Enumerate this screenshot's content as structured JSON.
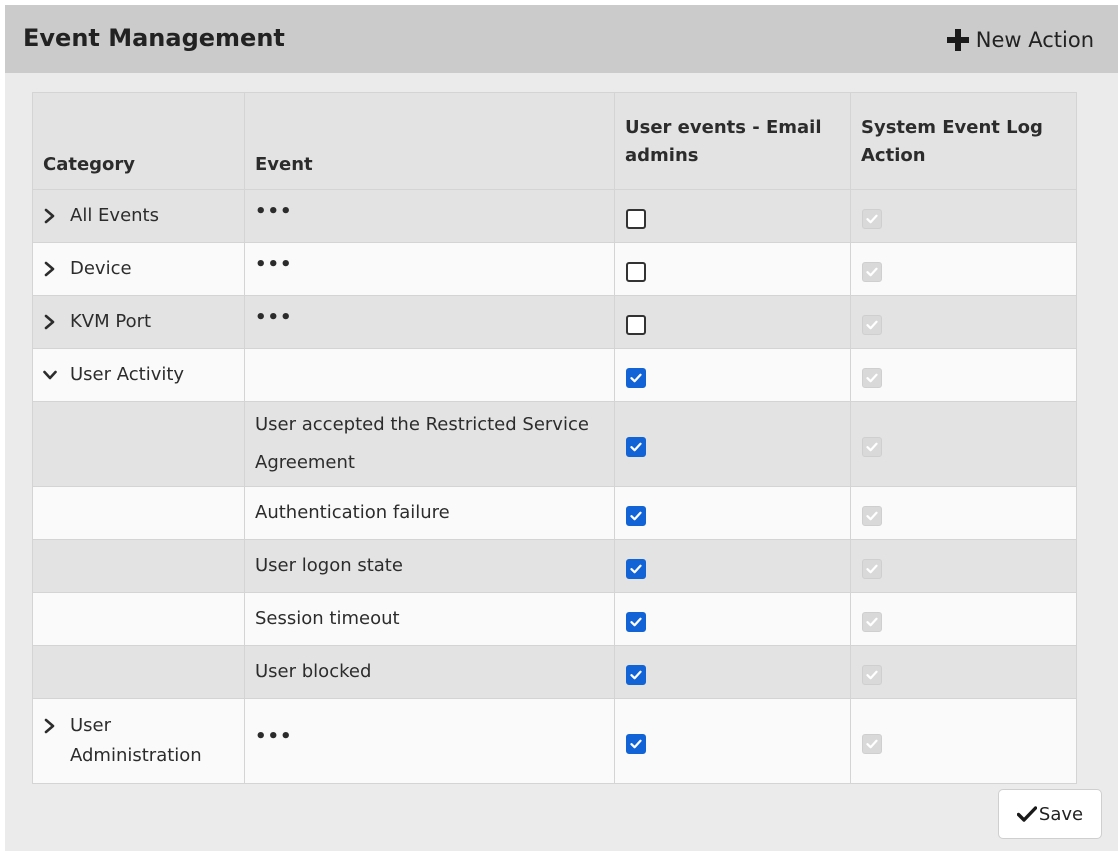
{
  "header": {
    "title": "Event Management",
    "new_action_label": "New Action"
  },
  "table": {
    "columns": [
      "Category",
      "Event",
      "User events - Email admins",
      "System Event Log Action"
    ],
    "rows": [
      {
        "category": "All Events",
        "expander": "collapsed",
        "event": "•••",
        "email_admins": false,
        "system_log": true
      },
      {
        "category": "Device",
        "expander": "collapsed",
        "event": "•••",
        "email_admins": false,
        "system_log": true
      },
      {
        "category": "KVM Port",
        "expander": "collapsed",
        "event": "•••",
        "email_admins": false,
        "system_log": true
      },
      {
        "category": "User Activity",
        "expander": "expanded",
        "event": "",
        "email_admins": true,
        "system_log": true
      },
      {
        "category": "",
        "expander": "none",
        "event": "User accepted the Restricted Service Agreement",
        "email_admins": true,
        "system_log": true
      },
      {
        "category": "",
        "expander": "none",
        "event": "Authentication failure",
        "email_admins": true,
        "system_log": true
      },
      {
        "category": "",
        "expander": "none",
        "event": "User logon state",
        "email_admins": true,
        "system_log": true
      },
      {
        "category": "",
        "expander": "none",
        "event": "Session timeout",
        "email_admins": true,
        "system_log": true
      },
      {
        "category": "",
        "expander": "none",
        "event": "User blocked",
        "email_admins": true,
        "system_log": true
      },
      {
        "category": "User Administration",
        "expander": "collapsed",
        "event": "•••",
        "email_admins": true,
        "system_log": true
      }
    ]
  },
  "footer": {
    "save_label": "Save"
  },
  "colors": {
    "header_bg": "#cbcbcb",
    "page_bg": "#ebebeb",
    "checkbox_checked": "#1264d6",
    "row_alt": "#e3e3e3"
  }
}
